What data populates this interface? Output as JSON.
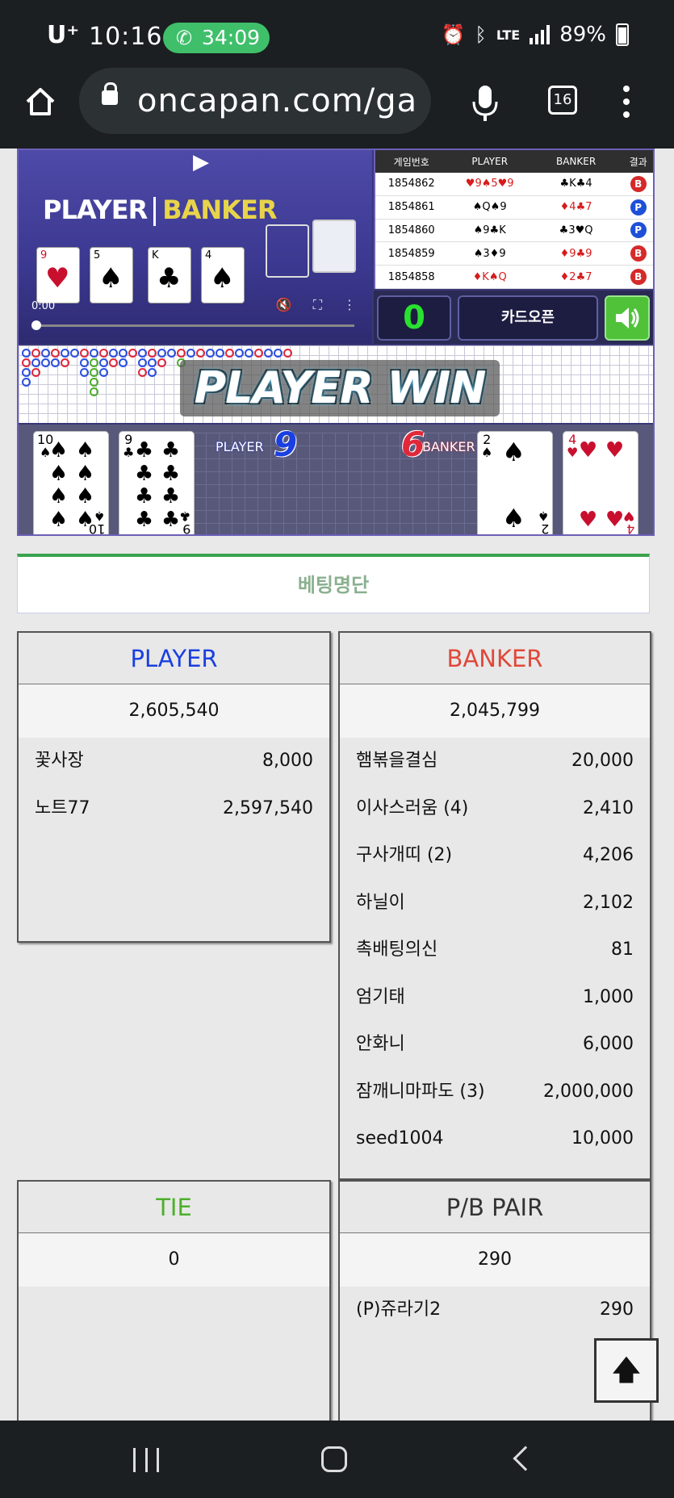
{
  "status_bar": {
    "carrier": "U⁺",
    "time": "10:16",
    "call_timer": "34:09",
    "network": "LTE",
    "battery": "89%"
  },
  "browser": {
    "url": "oncapan.com/ga",
    "tab_count": "16"
  },
  "game": {
    "video_time": "0:00",
    "overlay_player": "PLAYER",
    "overlay_banker": "BANKER",
    "history_headers": [
      "게임번호",
      "PLAYER",
      "BANKER",
      "결과"
    ],
    "history": [
      {
        "id": "1854862",
        "player": "♥9♠5♥9",
        "banker": "♣K♣4",
        "result": "B"
      },
      {
        "id": "1854861",
        "player": "♠Q♠9",
        "banker": "♦4♣7",
        "result": "P"
      },
      {
        "id": "1854860",
        "player": "♠9♣K",
        "banker": "♣3♥Q",
        "result": "P"
      },
      {
        "id": "1854859",
        "player": "♠3♦9",
        "banker": "♦9♣9",
        "result": "B"
      },
      {
        "id": "1854858",
        "player": "♦K♠Q",
        "banker": "♦2♣7",
        "result": "B"
      }
    ],
    "countdown": "0",
    "card_open_label": "카드오픈",
    "win_banner": "PLAYER WIN",
    "player_label": "PLAYER",
    "player_score": "9",
    "banker_label": "BANKER",
    "banker_score": "6"
  },
  "betting": {
    "title": "베팅명단",
    "player": {
      "label": "PLAYER",
      "total": "2,605,540",
      "entries": [
        {
          "name": "꽃사장",
          "amount": "8,000"
        },
        {
          "name": "노트77",
          "amount": "2,597,540"
        }
      ]
    },
    "banker": {
      "label": "BANKER",
      "total": "2,045,799",
      "entries": [
        {
          "name": "햄볶을결심",
          "amount": "20,000"
        },
        {
          "name": "이사스러움 (4)",
          "amount": "2,410"
        },
        {
          "name": "구사개띠 (2)",
          "amount": "4,206"
        },
        {
          "name": "하닐이",
          "amount": "2,102"
        },
        {
          "name": "촉배팅의신",
          "amount": "81"
        },
        {
          "name": "엄기태",
          "amount": "1,000"
        },
        {
          "name": "안화니",
          "amount": "6,000"
        },
        {
          "name": "잠깨니마파도 (3)",
          "amount": "2,000,000"
        },
        {
          "name": "seed1004",
          "amount": "10,000"
        }
      ]
    },
    "tie": {
      "label": "TIE",
      "total": "0"
    },
    "pair": {
      "label": "P/B PAIR",
      "total": "290",
      "entries": [
        {
          "name": "(P)쥬라기2",
          "amount": "290"
        }
      ]
    }
  },
  "colors": {
    "player": "#1a3fe0",
    "banker": "#e0483a",
    "tie": "#4caf2a",
    "pair": "#333333",
    "accent_green": "#3aa34d"
  },
  "icons": {
    "scroll_top": "arrow-up-icon"
  }
}
